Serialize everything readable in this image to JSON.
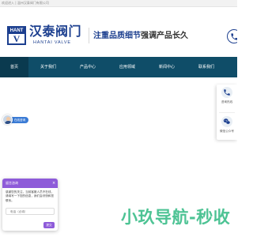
{
  "topbar": {
    "text": "欢迎进入 | 温州汉泰阀门有限公司"
  },
  "header": {
    "logo_letters": "HANT",
    "logo_mark": "V",
    "brand_name_cn": "汉泰阀门",
    "brand_name_en": "HANTAI VALVE",
    "slogan_part1": "注重品质细节",
    "slogan_part2": "强调产品长久"
  },
  "nav": {
    "items": [
      {
        "label": "首页",
        "active": true
      },
      {
        "label": "关于我们"
      },
      {
        "label": "产品中心"
      },
      {
        "label": "应用领域"
      },
      {
        "label": "新闻中心"
      },
      {
        "label": "联系我们"
      }
    ]
  },
  "float_panel": {
    "items": [
      {
        "label": "咨询热线",
        "icon": "phone-icon"
      },
      {
        "label": "微信公众号",
        "icon": "wechat-icon"
      }
    ]
  },
  "advisor": {
    "label": "在线咨询"
  },
  "chat": {
    "title": "留言咨询",
    "close": "×",
    "message": "感谢您的关注，当前客服人员不在线，请填写一下您的信息，我们会尽快和您联系。",
    "input_placeholder": "电话（必填）",
    "input_icon": "phone-icon",
    "send_label": "提交"
  },
  "watermark": {
    "text": "小玖导航-秒收"
  },
  "colors": {
    "brand_blue": "#1c3f8f",
    "nav_bg": "#0f4d68",
    "chat_purple": "#8e5bd9",
    "watermark_green": "#4dc394"
  }
}
